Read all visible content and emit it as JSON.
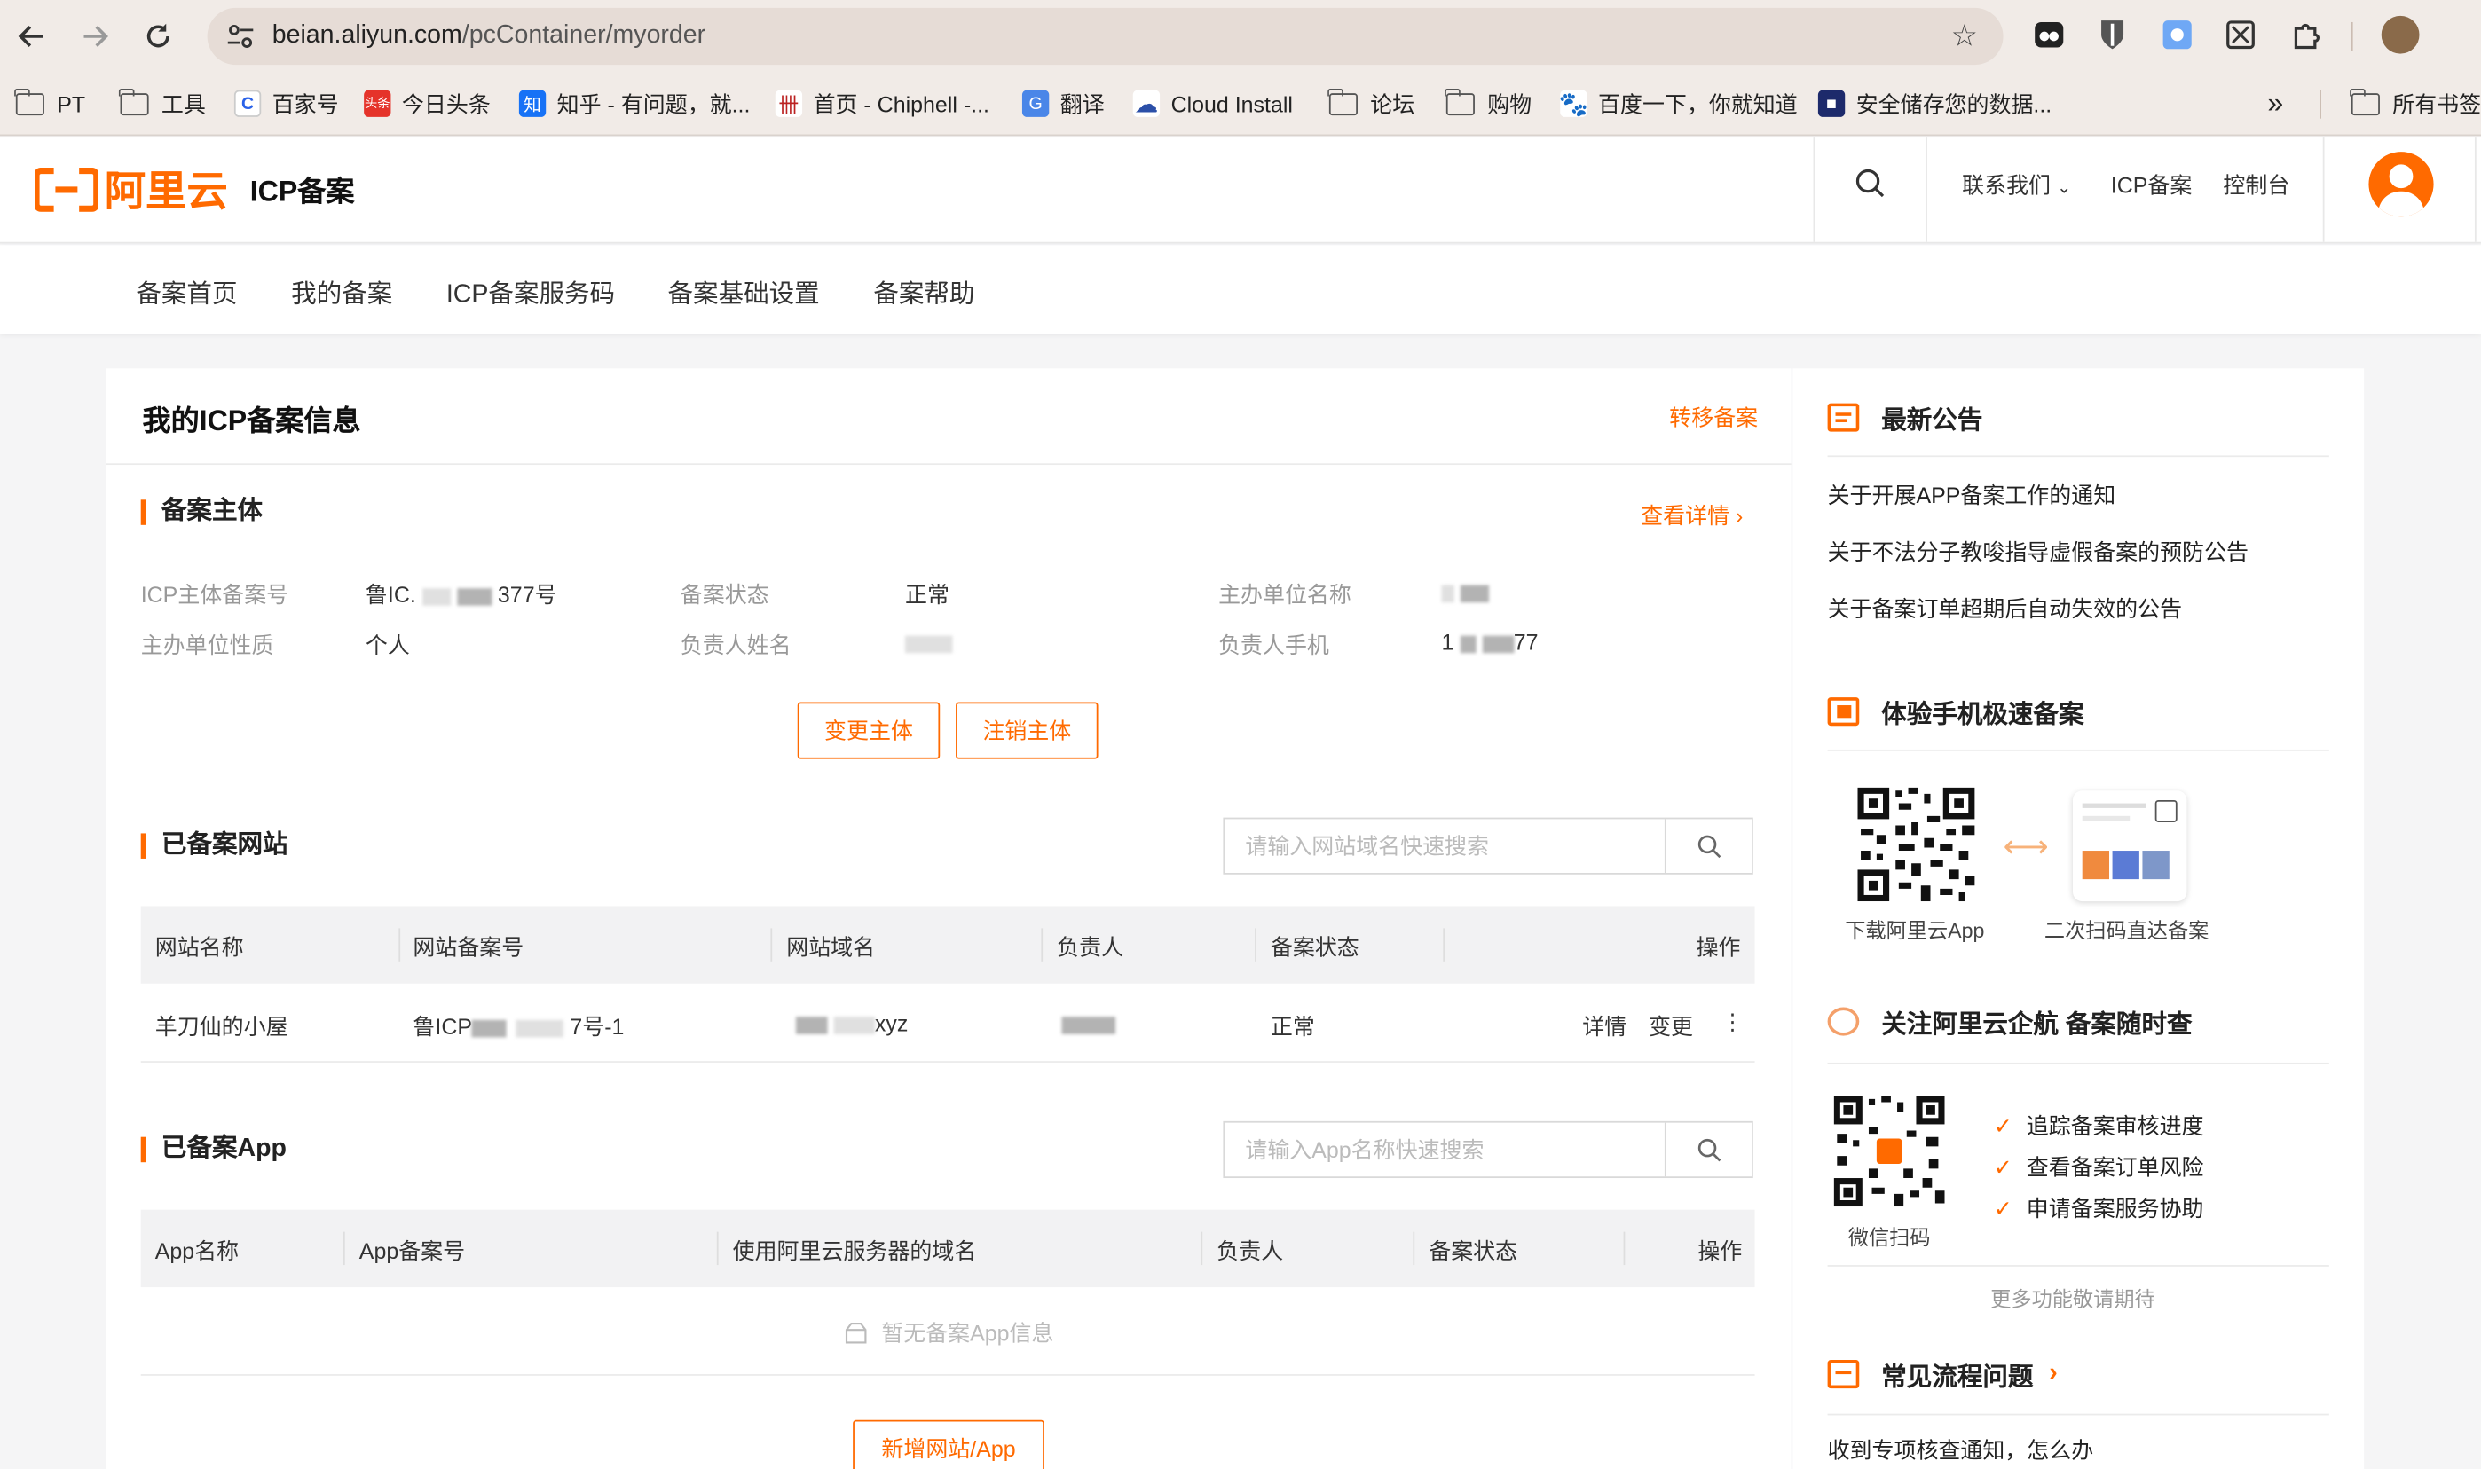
{
  "browser": {
    "url_host": "beian.aliyun.com",
    "url_path": "/pcContainer/myorder",
    "bookmarks": [
      {
        "label": "PT",
        "icon": "folder-icon"
      },
      {
        "label": "工具",
        "icon": "folder-icon"
      },
      {
        "label": "百家号",
        "icon": "baijiahao-icon"
      },
      {
        "label": "今日头条",
        "icon": "toutiao-icon"
      },
      {
        "label": "知乎 - 有问题，就...",
        "icon": "zhihu-icon"
      },
      {
        "label": "首页 - Chiphell -...",
        "icon": "chiphell-icon"
      },
      {
        "label": "翻译",
        "icon": "translate-icon"
      },
      {
        "label": "Cloud Install",
        "icon": "cloud-icon"
      },
      {
        "label": "论坛",
        "icon": "folder-icon"
      },
      {
        "label": "购物",
        "icon": "folder-icon"
      },
      {
        "label": "百度一下，你就知道",
        "icon": "baidu-icon"
      },
      {
        "label": "安全储存您的数据...",
        "icon": "storage-icon"
      }
    ],
    "overflow": "»",
    "all_bookmarks": "所有书签"
  },
  "header": {
    "logo_text": "阿里云",
    "title": "ICP备案",
    "contact": "联系我们",
    "icp": "ICP备案",
    "console": "控制台"
  },
  "subnav": [
    "备案首页",
    "我的备案",
    "ICP备案服务码",
    "备案基础设置",
    "备案帮助"
  ],
  "main": {
    "title": "我的ICP备案信息",
    "transfer": "转移备案",
    "subject": {
      "title": "备案主体",
      "detail_link": "查看详情",
      "labels": {
        "icp_no": "ICP主体备案号",
        "status": "备案状态",
        "org_name": "主办单位名称",
        "org_type": "主办单位性质",
        "person": "负责人姓名",
        "phone": "负责人手机"
      },
      "values": {
        "icp_no_prefix": "鲁IC.",
        "icp_no_suffix": "377号",
        "status": "正常",
        "org_type": "个人",
        "phone_prefix": "1",
        "phone_suffix": "77"
      },
      "change_btn": "变更主体",
      "cancel_btn": "注销主体"
    },
    "websites": {
      "title": "已备案网站",
      "search_placeholder": "请输入网站域名快速搜索",
      "columns": [
        "网站名称",
        "网站备案号",
        "网站域名",
        "负责人",
        "备案状态",
        "操作"
      ],
      "rows": [
        {
          "name": "羊刀仙的小屋",
          "icp_prefix": "鲁ICP",
          "icp_suffix": "7号-1",
          "domain_suffix": "xyz",
          "status": "正常",
          "action_detail": "详情",
          "action_change": "变更",
          "action_more": "⋮"
        }
      ]
    },
    "apps": {
      "title": "已备案App",
      "search_placeholder": "请输入App名称快速搜索",
      "columns": [
        "App名称",
        "App备案号",
        "使用阿里云服务器的域名",
        "负责人",
        "备案状态",
        "操作"
      ],
      "empty": "暂无备案App信息",
      "add_btn": "新增网站/App"
    }
  },
  "side": {
    "notice_title": "最新公告",
    "notices": [
      "关于开展APP备案工作的通知",
      "关于不法分子教唆指导虚假备案的预防公告",
      "关于备案订单超期后自动失效的公告"
    ],
    "mobile_title": "体验手机极速备案",
    "download_label": "下载阿里云App",
    "scan_label": "二次扫码直达备案",
    "wechat_title": "关注阿里云企航 备案随时查",
    "wechat_scan": "微信扫码",
    "features": [
      "追踪备案审核进度",
      "查看备案订单风险",
      "申请备案服务协助"
    ],
    "more": "更多功能敬请期待",
    "faq_title": "常见流程问题",
    "faq_first": "收到专项核查通知，怎么办"
  },
  "colors": {
    "accent": "#ff6a00",
    "chrome": "#f1ebe7",
    "page_bg": "#f5f5f6"
  }
}
